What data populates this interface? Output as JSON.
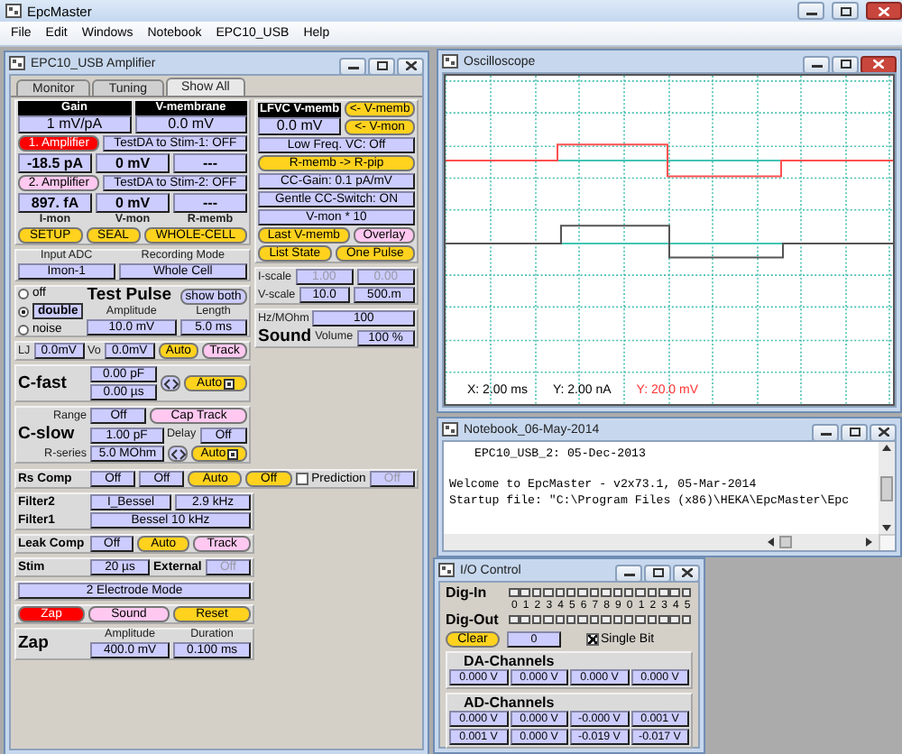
{
  "app": {
    "title": "EpcMaster",
    "menu": [
      "File",
      "Edit",
      "Windows",
      "Notebook",
      "EPC10_USB",
      "Help"
    ]
  },
  "amplifier": {
    "title": "EPC10_USB Amplifier",
    "active": false,
    "tabs": [
      {
        "label": "Monitor",
        "selected": false
      },
      {
        "label": "Tuning",
        "selected": false
      },
      {
        "label": "Show All",
        "selected": true
      }
    ],
    "left_sections": [
      {
        "rows": [
          [
            {
              "kind": "header_field",
              "label": "Gain",
              "value": "1 mV/pA"
            },
            {
              "kind": "header_field",
              "label": "V-membrane",
              "value": "0.0 mV"
            }
          ],
          [
            {
              "kind": "button",
              "label": "1. Amplifier",
              "color": "#ff0000"
            },
            {
              "kind": "field",
              "value": "TestDA to Stim-1: OFF"
            }
          ],
          [
            {
              "kind": "readout",
              "value": "-18.5 pA"
            },
            {
              "kind": "readout",
              "value": "0 mV"
            },
            {
              "kind": "readout",
              "value": "---"
            }
          ],
          [
            {
              "kind": "button",
              "label": "2. Amplifier",
              "color": "#ffc8f0"
            },
            {
              "kind": "field",
              "value": "TestDA to Stim-2: OFF"
            }
          ],
          [
            {
              "kind": "readout",
              "value": "897. fA"
            },
            {
              "kind": "readout",
              "value": "0 mV"
            },
            {
              "kind": "readout",
              "value": "---"
            }
          ],
          [
            {
              "kind": "caption",
              "text": "I-mon"
            },
            {
              "kind": "caption",
              "text": "V-mon"
            },
            {
              "kind": "caption",
              "text": "R-memb"
            }
          ],
          [
            {
              "kind": "button",
              "label": "SETUP",
              "color": "#ffd21e"
            },
            {
              "kind": "button",
              "label": "SEAL",
              "color": "#ffd21e"
            },
            {
              "kind": "button",
              "label": "WHOLE-CELL",
              "color": "#ffd21e"
            }
          ]
        ]
      },
      {
        "rows": [
          [
            {
              "kind": "group",
              "items": [
                {
                  "kind": "caption",
                  "text": "Input ADC"
                },
                {
                  "kind": "field",
                  "value": "Imon-1"
                }
              ]
            },
            {
              "kind": "group",
              "items": [
                {
                  "kind": "caption",
                  "text": "Recording Mode"
                },
                {
                  "kind": "field",
                  "value": "Whole Cell"
                }
              ]
            }
          ]
        ]
      },
      {
        "rows": [
          [
            {
              "kind": "radios",
              "options": [
                {
                  "label": "off",
                  "selected": false
                },
                {
                  "label": "double",
                  "selected": true
                },
                {
                  "label": "noise",
                  "selected": false
                }
              ]
            },
            {
              "kind": "group",
              "items": [
                {
                  "kind": "title",
                  "text": "Test Pulse"
                },
                {
                  "kind": "caption",
                  "text": "Amplitude"
                },
                {
                  "kind": "field",
                  "value": "10.0 mV"
                }
              ]
            },
            {
              "kind": "group",
              "items": [
                {
                  "kind": "button",
                  "label": "show both",
                  "color": "#ccccff"
                },
                {
                  "kind": "caption",
                  "text": "Length"
                },
                {
                  "kind": "field",
                  "value": "5.0 ms"
                }
              ]
            }
          ]
        ]
      },
      {
        "rows": [
          [
            {
              "kind": "caption",
              "text": "LJ"
            },
            {
              "kind": "field",
              "value": "0.0mV"
            },
            {
              "kind": "caption",
              "text": "Vo"
            },
            {
              "kind": "field",
              "value": "0.0mV"
            },
            {
              "kind": "button",
              "label": "Auto",
              "color": "#ffd21e"
            },
            {
              "kind": "button",
              "label": "Track",
              "color": "#ffc8f0"
            }
          ]
        ]
      },
      {
        "rows": [
          [
            {
              "kind": "title",
              "text": "C-fast"
            },
            {
              "kind": "group",
              "items": [
                {
                  "kind": "field",
                  "value": "0.00 pF"
                },
                {
                  "kind": "field",
                  "value": "0.00 µs"
                }
              ]
            },
            {
              "kind": "swap"
            },
            {
              "kind": "auto",
              "label": "Auto",
              "color": "#ffd21e"
            }
          ]
        ]
      },
      {
        "rows": [
          [
            {
              "kind": "caption",
              "text": "Range"
            },
            {
              "kind": "field",
              "value": "Off"
            },
            {
              "kind": "button",
              "label": "Cap Track",
              "color": "#ffc8f0"
            }
          ],
          [
            {
              "kind": "title",
              "text": "C-slow"
            },
            {
              "kind": "field",
              "value": "1.00 pF"
            },
            {
              "kind": "caption",
              "text": "Delay"
            },
            {
              "kind": "field",
              "value": "Off"
            }
          ],
          [
            {
              "kind": "caption",
              "text": "R-series"
            },
            {
              "kind": "field",
              "value": "5.0 MOhm"
            },
            {
              "kind": "swap"
            },
            {
              "kind": "auto",
              "label": "Auto",
              "color": "#ffd21e"
            }
          ]
        ]
      }
    ],
    "right_sections": [
      {
        "rows": [
          [
            {
              "kind": "header_field",
              "label": "LFVC V-memb",
              "value": "0.0 mV"
            },
            {
              "kind": "group",
              "items": [
                {
                  "kind": "button",
                  "label": "<- V-memb",
                  "color": "#ffd21e"
                },
                {
                  "kind": "button",
                  "label": "<- V-mon",
                  "color": "#ffd21e"
                }
              ]
            }
          ],
          [
            {
              "kind": "field",
              "value": "Low Freq. VC: Off"
            }
          ],
          [
            {
              "kind": "button",
              "label": "R-memb -> R-pip",
              "color": "#ffd21e"
            }
          ],
          [
            {
              "kind": "field",
              "value": "CC-Gain: 0.1 pA/mV"
            }
          ],
          [
            {
              "kind": "field",
              "value": "Gentle CC-Switch: ON"
            }
          ],
          [
            {
              "kind": "field",
              "value": "V-mon * 10"
            }
          ],
          [
            {
              "kind": "button",
              "label": "Last V-memb",
              "color": "#ffd21e"
            },
            {
              "kind": "button",
              "label": "Overlay",
              "color": "#ffc8f0"
            }
          ],
          [
            {
              "kind": "button",
              "label": "List State",
              "color": "#ffd21e"
            },
            {
              "kind": "button",
              "label": "One Pulse",
              "color": "#ffd21e"
            }
          ]
        ]
      },
      {
        "rows": [
          [
            {
              "kind": "caption",
              "text": "I-scale"
            },
            {
              "kind": "field",
              "value": "1.00",
              "disabled": true
            },
            {
              "kind": "field",
              "value": "0.00",
              "disabled": true
            }
          ],
          [
            {
              "kind": "caption",
              "text": "V-scale"
            },
            {
              "kind": "field",
              "value": "10.0"
            },
            {
              "kind": "field",
              "value": "500.m"
            }
          ]
        ]
      },
      {
        "rows": [
          [
            {
              "kind": "caption",
              "text": "Hz/MOhm"
            },
            {
              "kind": "field",
              "value": "100"
            }
          ],
          [
            {
              "kind": "title",
              "text": "Sound"
            },
            {
              "kind": "caption",
              "text": "Volume"
            },
            {
              "kind": "field",
              "value": "100 %"
            }
          ]
        ]
      }
    ],
    "bottom_sections": [
      {
        "rows": [
          [
            {
              "kind": "label",
              "text": "Rs Comp"
            },
            {
              "kind": "field",
              "value": "Off"
            },
            {
              "kind": "field",
              "value": "Off"
            },
            {
              "kind": "button",
              "label": "Auto",
              "color": "#ffd21e"
            },
            {
              "kind": "button",
              "label": "Off",
              "color": "#ffd21e"
            },
            {
              "kind": "checkbox",
              "label": "Prediction",
              "checked": false
            },
            {
              "kind": "field",
              "value": "Off",
              "disabled": true
            }
          ]
        ]
      },
      {
        "rows": [
          [
            {
              "kind": "label",
              "text": "Filter2"
            },
            {
              "kind": "field",
              "value": "I_Bessel"
            },
            {
              "kind": "field",
              "value": "2.9 kHz"
            }
          ],
          [
            {
              "kind": "label",
              "text": "Filter1"
            },
            {
              "kind": "field",
              "value": "Bessel 10 kHz"
            }
          ]
        ]
      },
      {
        "rows": [
          [
            {
              "kind": "label",
              "text": "Leak Comp"
            },
            {
              "kind": "field",
              "value": "Off"
            },
            {
              "kind": "button",
              "label": "Auto",
              "color": "#ffd21e"
            },
            {
              "kind": "button",
              "label": "Track",
              "color": "#ffc8f0"
            }
          ]
        ]
      },
      {
        "rows": [
          [
            {
              "kind": "label",
              "text": "Stim"
            },
            {
              "kind": "field",
              "value": "20 µs"
            },
            {
              "kind": "label",
              "text": "External"
            },
            {
              "kind": "field",
              "value": "Off",
              "disabled": true
            }
          ]
        ]
      },
      {
        "rows": [
          [
            {
              "kind": "field",
              "value": "2 Electrode Mode"
            }
          ]
        ]
      },
      {
        "rows": [
          [
            {
              "kind": "button",
              "label": "Zap",
              "color": "#ff0000"
            },
            {
              "kind": "button",
              "label": "Sound",
              "color": "#ffc8f0"
            },
            {
              "kind": "button",
              "label": "Reset",
              "color": "#ffd21e"
            }
          ]
        ]
      },
      {
        "rows": [
          [
            {
              "kind": "title",
              "text": "Zap"
            },
            {
              "kind": "group",
              "items": [
                {
                  "kind": "caption",
                  "text": "Amplitude"
                },
                {
                  "kind": "field",
                  "value": "400.0 mV"
                }
              ]
            },
            {
              "kind": "group",
              "items": [
                {
                  "kind": "caption",
                  "text": "Duration"
                },
                {
                  "kind": "field",
                  "value": "0.100 ms"
                }
              ]
            }
          ]
        ]
      }
    ]
  },
  "oscilloscope": {
    "title": "Oscilloscope",
    "active": true,
    "scales": [
      {
        "text": "X: 2.00 ms",
        "color": "#000000"
      },
      {
        "text": "Y: 2.00 nA",
        "color": "#000000"
      },
      {
        "text": "Y: 20.0 mV",
        "color": "#ff3333"
      }
    ]
  },
  "notebook": {
    "title": "Notebook_06-May-2014",
    "active": false,
    "lines": [
      "EPC10_USB_2: 05-Dec-2013",
      "Welcome to EpcMaster - v2x73.1, 05-Mar-2014",
      "Startup file: \"C:\\Program Files (x86)\\HEKA\\EpcMaster\\Epc"
    ]
  },
  "io_control": {
    "title": "I/O Control",
    "active": false,
    "dig_in": {
      "label": "Dig-In",
      "bits": [
        {
          "checked": false
        },
        {
          "checked": false
        },
        {
          "checked": false
        },
        {
          "checked": false
        },
        {
          "checked": false
        },
        {
          "checked": false
        },
        {
          "checked": false
        },
        {
          "checked": false
        },
        {
          "checked": false
        },
        {
          "checked": false
        },
        {
          "checked": false
        },
        {
          "checked": false
        },
        {
          "checked": false
        },
        {
          "checked": false
        },
        {
          "checked": false
        },
        {
          "checked": false
        }
      ]
    },
    "bit_numbers": [
      "0",
      "1",
      "2",
      "3",
      "4",
      "5",
      "6",
      "7",
      "8",
      "9",
      "0",
      "1",
      "2",
      "3",
      "4",
      "5"
    ],
    "dig_out": {
      "label": "Dig-Out",
      "bits": [
        {
          "checked": false
        },
        {
          "checked": false
        },
        {
          "checked": false
        },
        {
          "checked": false
        },
        {
          "checked": false
        },
        {
          "checked": false
        },
        {
          "checked": false
        },
        {
          "checked": false
        },
        {
          "checked": false
        },
        {
          "checked": false
        },
        {
          "checked": false
        },
        {
          "checked": false
        },
        {
          "checked": false
        },
        {
          "checked": false
        },
        {
          "checked": false
        },
        {
          "checked": false
        }
      ]
    },
    "clear_button": "Clear",
    "value": "0",
    "single_bit": {
      "label": "Single Bit",
      "checked": true
    },
    "da": {
      "label": "DA-Channels",
      "values": [
        "0.000 V",
        "0.000 V",
        "0.000 V",
        "0.000 V"
      ]
    },
    "ad": {
      "label": "AD-Channels",
      "values": [
        "0.000 V",
        "0.000 V",
        "-0.000 V",
        "0.001 V",
        "0.001 V",
        "0.000 V",
        "-0.019 V",
        "-0.017 V"
      ]
    }
  }
}
